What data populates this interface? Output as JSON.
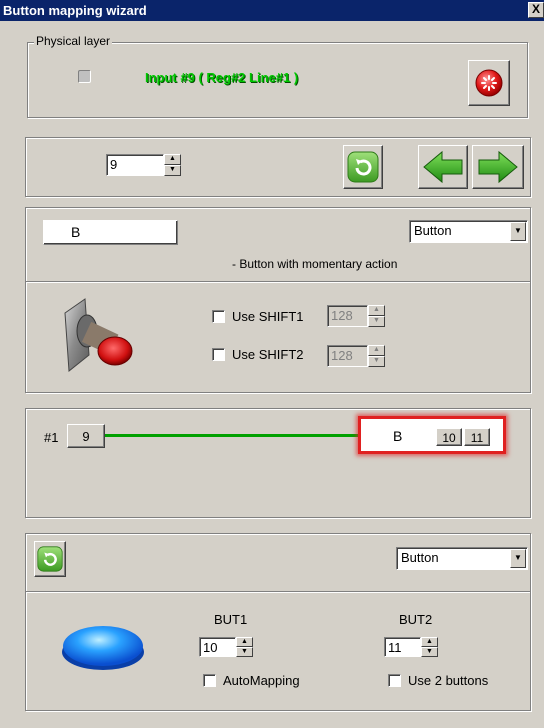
{
  "window": {
    "title": "Button mapping wizard",
    "close_glyph": "X"
  },
  "physical": {
    "legend": "Physical layer",
    "input_text": "Input #9 ( Reg#2  Line#1 )",
    "input_color": "#00c800"
  },
  "navigation": {
    "index_value": "9"
  },
  "mapping": {
    "key_value": "B",
    "type_selected": "Button",
    "description": "- Button with momentary action",
    "shift1_label": "Use SHIFT1",
    "shift1_value": "128",
    "shift2_label": "Use SHIFT2",
    "shift2_value": "128"
  },
  "connection": {
    "row_label": "#1",
    "source_value": "9",
    "target_key": "B",
    "target_a": "10",
    "target_b": "11",
    "line_color": "#00a000",
    "highlight_color": "#e02020"
  },
  "logical": {
    "type_selected": "Button",
    "but1_label": "BUT1",
    "but1_value": "10",
    "but2_label": "BUT2",
    "but2_value": "11",
    "automapping_label": "AutoMapping",
    "use2buttons_label": "Use 2 buttons"
  }
}
